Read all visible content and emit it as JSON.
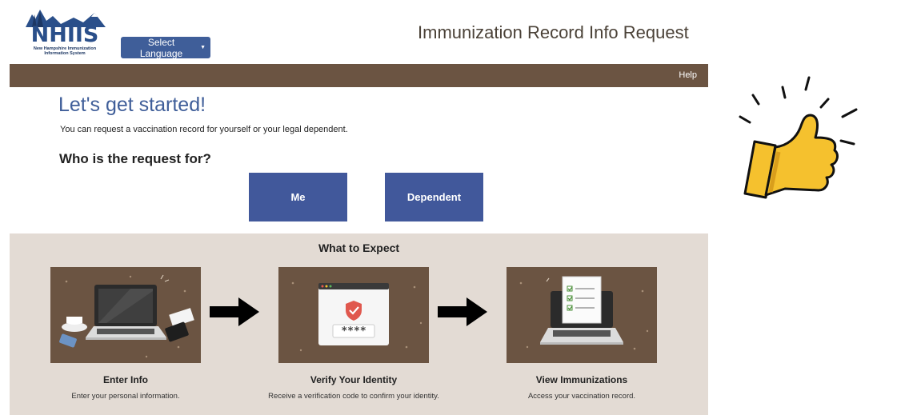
{
  "header": {
    "logo_text": "NHIIS",
    "logo_subtitle": "New Hampshire Immunization\nInformation System",
    "language_button": "Select Language",
    "page_title": "Immunization Record Info Request",
    "help_link": "Help"
  },
  "main": {
    "heading": "Let's get started!",
    "intro": "You can request a vaccination record for yourself or your legal dependent.",
    "question": "Who is the request for?",
    "btn_me": "Me",
    "btn_dependent": "Dependent"
  },
  "expect": {
    "title": "What to Expect",
    "code_mask": "****",
    "steps": [
      {
        "title": "Enter Info",
        "desc": "Enter your personal information."
      },
      {
        "title": "Verify Your Identity",
        "desc": "Receive a verification code to confirm your identity."
      },
      {
        "title": "View Immunizations",
        "desc": "Access your vaccination record."
      }
    ]
  },
  "colors": {
    "brand_blue": "#3f5e99",
    "nav_brown": "#6b5442",
    "section_beige": "#e3dbd4",
    "thumb_yellow": "#f5c12e"
  },
  "icons": [
    "thumbs-up-icon",
    "arrow-right-icon",
    "shield-check-icon",
    "laptop-icon",
    "checklist-icon"
  ]
}
